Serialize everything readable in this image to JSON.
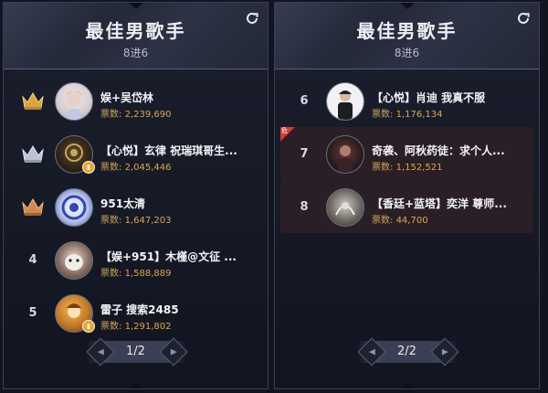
{
  "panels": [
    {
      "title": "最佳男歌手",
      "subtitle": "8进6",
      "page": "1/2",
      "rows": [
        {
          "rank": "1",
          "name": "娱+吴岱林",
          "votes_label": "票数:",
          "votes": "2,239,690"
        },
        {
          "rank": "2",
          "name": "【心悦】玄律 祝瑞琪哥生...",
          "votes_label": "票数:",
          "votes": "2,045,446"
        },
        {
          "rank": "3",
          "name": "951太清",
          "votes_label": "票数:",
          "votes": "1,647,203"
        },
        {
          "rank": "4",
          "name": "【娱+951】木槿@文征 ...",
          "votes_label": "票数:",
          "votes": "1,588,889"
        },
        {
          "rank": "5",
          "name": "雷子 搜索2485",
          "votes_label": "票数:",
          "votes": "1,291,802"
        }
      ]
    },
    {
      "title": "最佳男歌手",
      "subtitle": "8进6",
      "page": "2/2",
      "rows": [
        {
          "rank": "6",
          "name": "【心悦】肖迪 我真不服",
          "votes_label": "票数:",
          "votes": "1,176,134"
        },
        {
          "rank": "7",
          "name": "奇袭、阿秋药徒：求个人...",
          "votes_label": "票数:",
          "votes": "1,152,521",
          "tag": "危"
        },
        {
          "rank": "8",
          "name": "【香廷+蓝塔】奕洋 尊师...",
          "votes_label": "票数:",
          "votes": "44,700"
        }
      ]
    }
  ],
  "colors": {
    "gold_crown": "#d9a441",
    "silver_crown": "#b9c3d3",
    "bronze_crown": "#d08a4f",
    "highlight_row": "#2a1f26",
    "danger_tag": "#d33a3a"
  },
  "icons": {
    "refresh": "refresh-icon",
    "crown": "crown-icon",
    "prev": "chevron-left-icon",
    "next": "chevron-right-icon"
  }
}
